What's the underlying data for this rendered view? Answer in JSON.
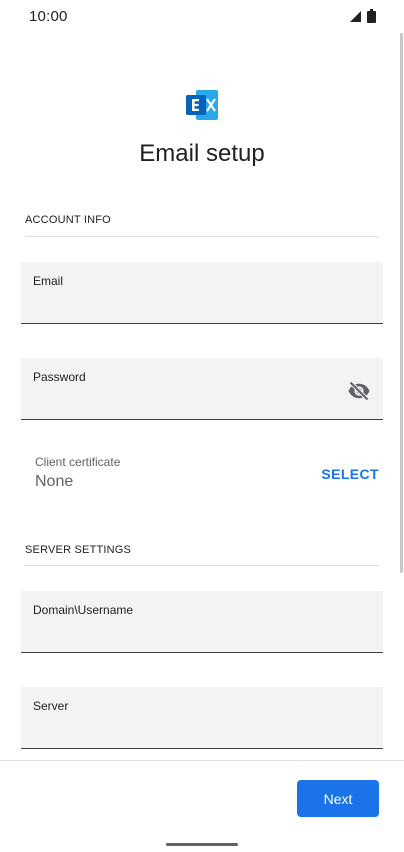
{
  "status_bar": {
    "time": "10:00",
    "icons": [
      "signal-icon",
      "battery-icon"
    ]
  },
  "header": {
    "logo_icon": "exchange-logo-icon",
    "title": "Email setup"
  },
  "account_info": {
    "section_label": "ACCOUNT INFO",
    "email": {
      "label": "Email",
      "value": ""
    },
    "password": {
      "label": "Password",
      "value": "",
      "toggle_icon": "visibility-off-icon"
    },
    "client_certificate": {
      "label": "Client certificate",
      "value": "None",
      "action_label": "SELECT"
    }
  },
  "server_settings": {
    "section_label": "SERVER SETTINGS",
    "domain_username": {
      "label": "Domain\\Username",
      "value": ""
    },
    "server": {
      "label": "Server",
      "value": ""
    }
  },
  "footer": {
    "next_label": "Next"
  },
  "colors": {
    "accent": "#1a73e8",
    "field_background": "#f1f3f4",
    "exchange_blue": "#0364b8"
  }
}
